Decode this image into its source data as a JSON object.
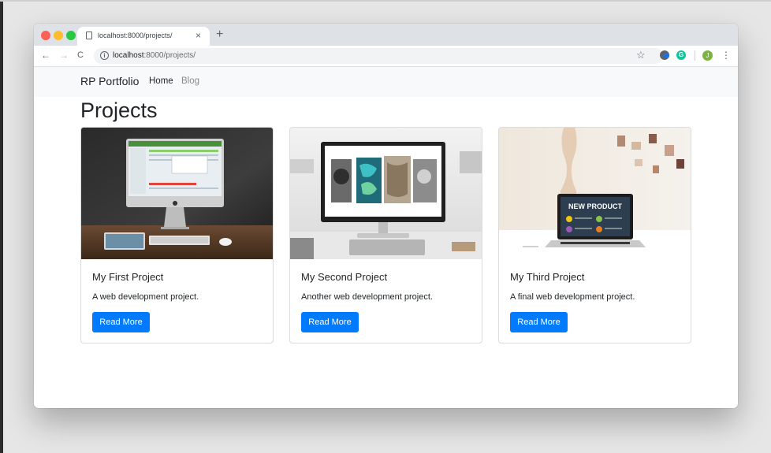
{
  "browser": {
    "tab": {
      "title": "localhost:8000/projects/",
      "close_icon": "×"
    },
    "new_tab_icon": "+",
    "nav": {
      "back_icon": "←",
      "forward_icon": "→",
      "reload_icon": "C"
    },
    "address": {
      "host": "localhost",
      "path": ":8000/projects/"
    },
    "bookmark_icon": "☆",
    "extensions": {
      "grammarly_letter": "G"
    },
    "profile_initial": "J",
    "menu_icon": "⋮"
  },
  "site": {
    "brand": "RP Portfolio",
    "nav": {
      "home": "Home",
      "blog": "Blog"
    },
    "page_title": "Projects"
  },
  "projects": [
    {
      "title": "My First Project",
      "description": "A web development project.",
      "button": "Read More"
    },
    {
      "title": "My Second Project",
      "description": "Another web development project.",
      "button": "Read More"
    },
    {
      "title": "My Third Project",
      "description": "A final web development project.",
      "button": "Read More"
    }
  ],
  "product_screen": {
    "heading": "NEW PRODUCT"
  },
  "colors": {
    "primary": "#007bff",
    "navbar_bg": "#f8f9fa",
    "tabbar_bg": "#dee1e6"
  }
}
